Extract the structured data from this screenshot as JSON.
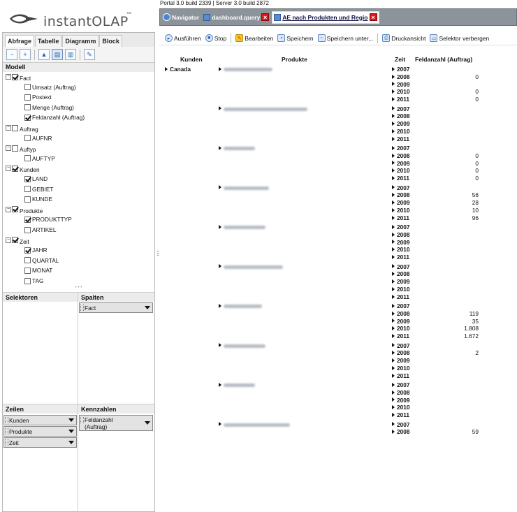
{
  "logo": {
    "title": "instantOLAP",
    "tm": "™"
  },
  "left": {
    "tabs": [
      "Abfrage",
      "Tabelle",
      "Diagramm",
      "Block"
    ],
    "model_heading": "Modell",
    "tree": [
      {
        "label": "Fact",
        "checked": true,
        "group": true
      },
      {
        "label": "Umsatz (Auftrag)",
        "checked": false
      },
      {
        "label": "Postext",
        "checked": false
      },
      {
        "label": "Menge (Auftrag)",
        "checked": false
      },
      {
        "label": "Feldanzahl (Auftrag)",
        "checked": true
      },
      {
        "label": "Auftrag",
        "checked": false,
        "group": true
      },
      {
        "label": "AUFNR",
        "checked": false
      },
      {
        "label": "Auftyp",
        "checked": false,
        "group": true
      },
      {
        "label": "AUFTYP",
        "checked": false
      },
      {
        "label": "Kunden",
        "checked": true,
        "group": true
      },
      {
        "label": "LAND",
        "checked": true
      },
      {
        "label": "GEBIET",
        "checked": false
      },
      {
        "label": "KUNDE",
        "checked": false
      },
      {
        "label": "Produkte",
        "checked": true,
        "group": true
      },
      {
        "label": "PRODUKTTYP",
        "checked": true
      },
      {
        "label": "ARTIKEL",
        "checked": false
      },
      {
        "label": "Zeit",
        "checked": true,
        "group": true
      },
      {
        "label": "JAHR",
        "checked": true
      },
      {
        "label": "QUARTAL",
        "checked": false
      },
      {
        "label": "MONAT",
        "checked": false
      },
      {
        "label": "TAG",
        "checked": false
      }
    ],
    "selektoren": "Selektoren",
    "spalten": "Spalten",
    "spalten_fields": [
      "Fact"
    ],
    "zeilen": "Zeilen",
    "zeilen_fields": [
      "Kunden",
      "Produkte",
      "Zeit"
    ],
    "kennzahlen": "Kennzahlen",
    "kennzahlen_fields": [
      "Feldanzahl (Auftrag)"
    ]
  },
  "status": "Portal 3.0 build 2339 | Server 3.0 build 2872",
  "doctabs": {
    "navigator": "Navigator",
    "dashboard": "dashboard.query",
    "active": "AE nach Produkten und Regio"
  },
  "toolbar": {
    "run": "Ausführen",
    "stop": "Stop",
    "edit": "Bearbeiten",
    "save": "Speichern",
    "save_as": "Speichern unter...",
    "print": "Druckansicht",
    "hide_selector": "Selektor verbergen"
  },
  "grid": {
    "headers": {
      "kunden": "Kunden",
      "produkte": "Produkte",
      "zeit": "Zeit",
      "measure": "Feldanzahl (Auftrag)"
    },
    "customer": "Canada",
    "groups": [
      {
        "blur_w": 70,
        "rows": [
          [
            "2007",
            ""
          ],
          [
            "2008",
            "0"
          ],
          [
            "2009",
            ""
          ],
          [
            "2010",
            "0"
          ],
          [
            "2011",
            "0"
          ]
        ]
      },
      {
        "blur_w": 120,
        "rows": [
          [
            "2007",
            ""
          ],
          [
            "2008",
            ""
          ],
          [
            "2009",
            ""
          ],
          [
            "2010",
            ""
          ],
          [
            "2011",
            ""
          ]
        ]
      },
      {
        "blur_w": 45,
        "rows": [
          [
            "2007",
            ""
          ],
          [
            "2008",
            "0"
          ],
          [
            "2009",
            "0"
          ],
          [
            "2010",
            "0"
          ],
          [
            "2011",
            "0"
          ]
        ]
      },
      {
        "blur_w": 65,
        "rows": [
          [
            "2007",
            ""
          ],
          [
            "2008",
            "56"
          ],
          [
            "2009",
            "28"
          ],
          [
            "2010",
            "10"
          ],
          [
            "2011",
            "96"
          ]
        ]
      },
      {
        "blur_w": 60,
        "rows": [
          [
            "2007",
            ""
          ],
          [
            "2008",
            ""
          ],
          [
            "2009",
            ""
          ],
          [
            "2010",
            ""
          ],
          [
            "2011",
            ""
          ]
        ]
      },
      {
        "blur_w": 85,
        "rows": [
          [
            "2007",
            ""
          ],
          [
            "2008",
            ""
          ],
          [
            "2009",
            ""
          ],
          [
            "2010",
            ""
          ],
          [
            "2011",
            ""
          ]
        ]
      },
      {
        "blur_w": 55,
        "rows": [
          [
            "2007",
            ""
          ],
          [
            "2008",
            "119"
          ],
          [
            "2009",
            "35"
          ],
          [
            "2010",
            "1.808"
          ],
          [
            "2011",
            "1.672"
          ]
        ]
      },
      {
        "blur_w": 60,
        "rows": [
          [
            "2007",
            ""
          ],
          [
            "2008",
            "2"
          ],
          [
            "2009",
            ""
          ],
          [
            "2010",
            ""
          ],
          [
            "2011",
            ""
          ]
        ]
      },
      {
        "blur_w": 45,
        "rows": [
          [
            "2007",
            ""
          ],
          [
            "2008",
            ""
          ],
          [
            "2009",
            ""
          ],
          [
            "2010",
            ""
          ],
          [
            "2011",
            ""
          ]
        ]
      },
      {
        "blur_w": 95,
        "rows": [
          [
            "2007",
            ""
          ],
          [
            "2008",
            "59"
          ]
        ]
      }
    ]
  },
  "colors": {
    "tabbar": "#8c939b",
    "close": "#d01b1b",
    "accent": "#2c64a8"
  }
}
